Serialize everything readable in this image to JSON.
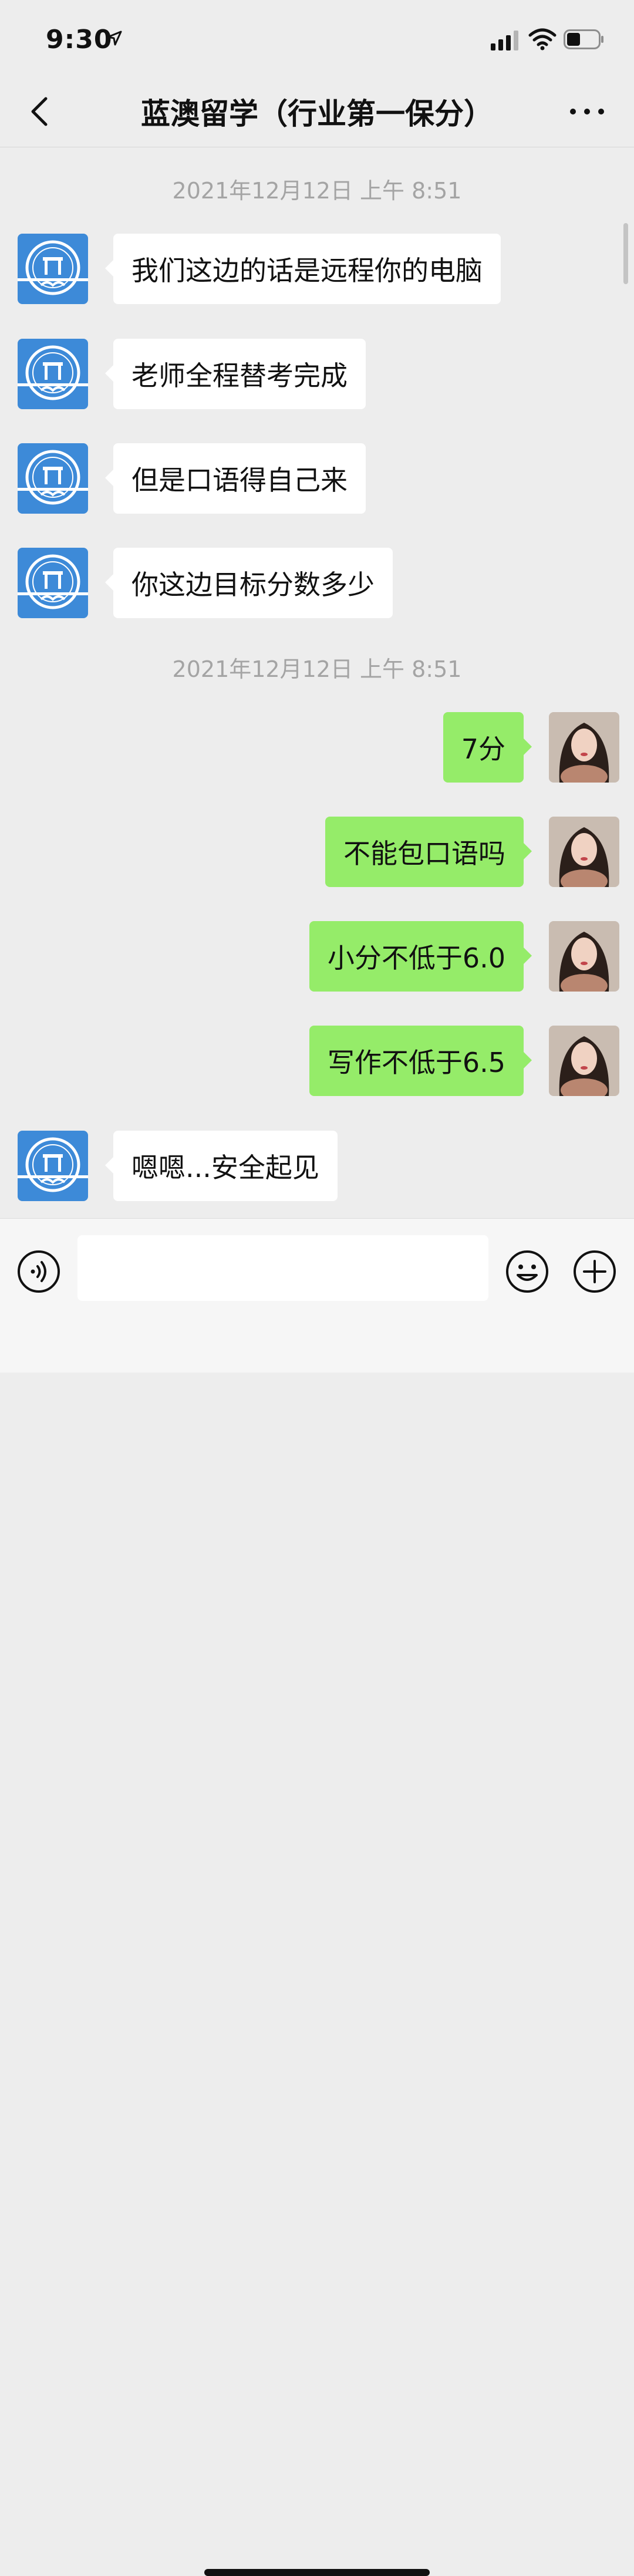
{
  "status_bar": {
    "time": "9:30"
  },
  "nav": {
    "title": "蓝澳留学（行业第一保分）"
  },
  "chat": {
    "timestamps": [
      "2021年12月12日 上午 8:51",
      "2021年12月12日 上午 8:51"
    ],
    "messages": [
      {
        "side": "in",
        "text": "我们这边的话是远程你的电脑"
      },
      {
        "side": "in",
        "text": "老师全程替考完成"
      },
      {
        "side": "in",
        "text": "但是口语得自己来"
      },
      {
        "side": "in",
        "text": "你这边目标分数多少"
      },
      {
        "side": "out",
        "text": "7分"
      },
      {
        "side": "out",
        "text": "不能包口语吗"
      },
      {
        "side": "out",
        "text": "小分不低于6.0"
      },
      {
        "side": "out",
        "text": "写作不低于6.5"
      },
      {
        "side": "in",
        "text": "嗯嗯...安全起见"
      }
    ]
  },
  "input_bar": {
    "value": "",
    "placeholder": ""
  },
  "colors": {
    "incoming_bubble": "#ffffff",
    "outgoing_bubble": "#95ec69",
    "contact_avatar": "#3d8ad8",
    "background": "#ededed"
  },
  "icons": [
    "back-icon",
    "more-icon",
    "voice-icon",
    "emoji-icon",
    "plus-icon",
    "location-arrow-icon",
    "signal-icon",
    "wifi-icon",
    "battery-icon"
  ]
}
